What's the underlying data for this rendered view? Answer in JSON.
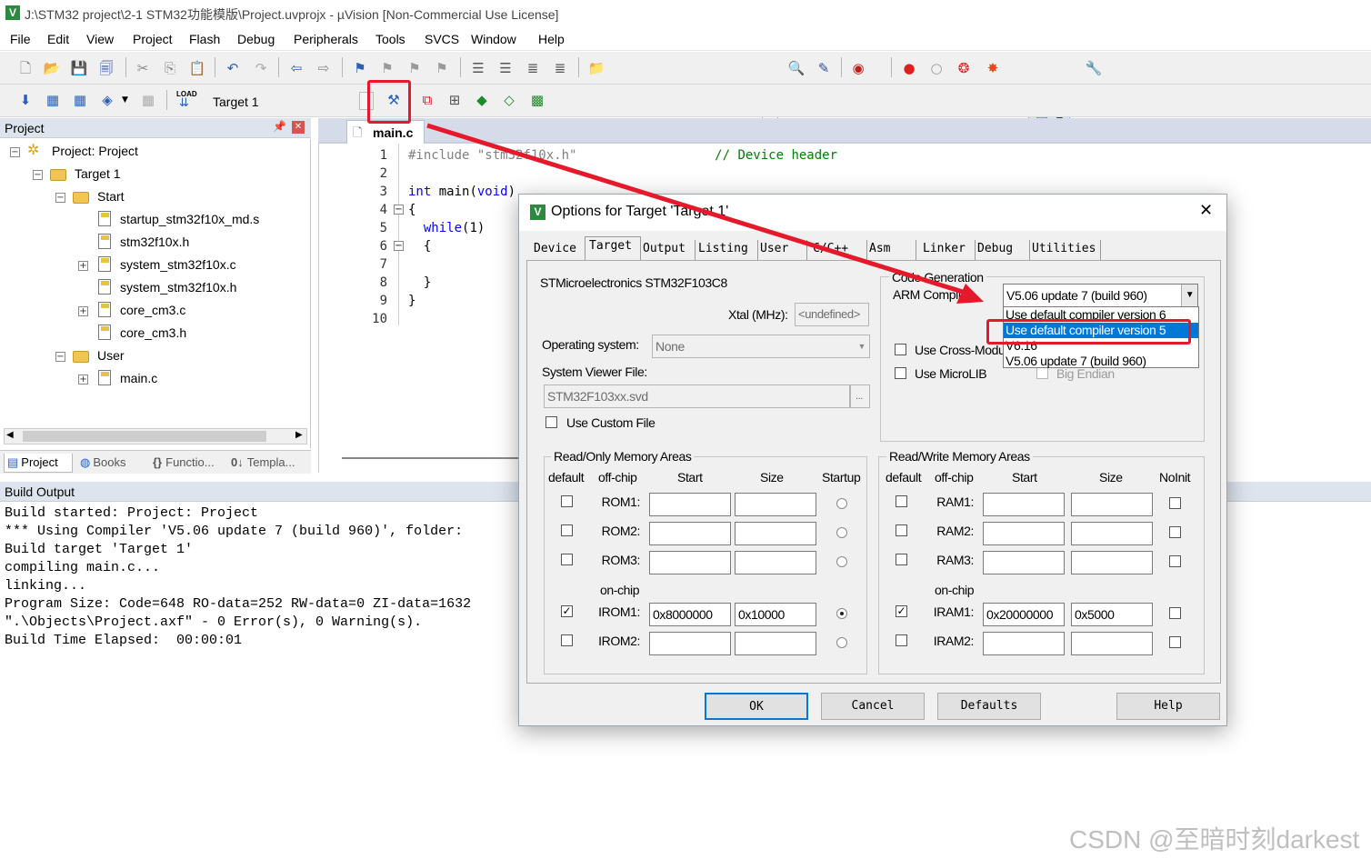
{
  "window": {
    "title": "J:\\STM32 project\\2-1 STM32功能模版\\Project.uvprojx - µVision  [Non-Commercial Use License]",
    "app_icon": "V"
  },
  "menu": [
    "File",
    "Edit",
    "View",
    "Project",
    "Flash",
    "Debug",
    "Peripherals",
    "Tools",
    "SVCS",
    "Window",
    "Help"
  ],
  "toolbar2": {
    "target_select": "Target 1",
    "load_label": "LOAD"
  },
  "project_panel": {
    "title": "Project",
    "tree": [
      {
        "label": "Project: Project",
        "kind": "root"
      },
      {
        "label": "Target 1",
        "kind": "target"
      },
      {
        "label": "Start",
        "kind": "folder"
      },
      {
        "label": "startup_stm32f10x_md.s",
        "kind": "file"
      },
      {
        "label": "stm32f10x.h",
        "kind": "file"
      },
      {
        "label": "system_stm32f10x.c",
        "kind": "file"
      },
      {
        "label": "system_stm32f10x.h",
        "kind": "file"
      },
      {
        "label": "core_cm3.c",
        "kind": "file"
      },
      {
        "label": "core_cm3.h",
        "kind": "file"
      },
      {
        "label": "User",
        "kind": "folder"
      },
      {
        "label": "main.c",
        "kind": "file"
      }
    ],
    "tabs": [
      "Project",
      "Books",
      "Functio...",
      "Templa..."
    ]
  },
  "editor": {
    "tab_label": "main.c",
    "lines": [
      {
        "num": "1",
        "segments": [
          {
            "text": "#include \"stm32f10x.h\"",
            "color": "#808080"
          },
          {
            "text": "                  // Device header",
            "color": "#008000"
          }
        ]
      },
      {
        "num": "2",
        "segments": []
      },
      {
        "num": "3",
        "segments": [
          {
            "text": "int",
            "color": "#0000ff"
          },
          {
            "text": " main(",
            "color": "#000000"
          },
          {
            "text": "void",
            "color": "#0000ff"
          },
          {
            "text": ")",
            "color": "#000000"
          }
        ]
      },
      {
        "num": "4",
        "segments": [
          {
            "text": "{",
            "color": "#000000"
          }
        ]
      },
      {
        "num": "5",
        "segments": [
          {
            "text": "  ",
            "color": "#000000"
          },
          {
            "text": "while",
            "color": "#0000ff"
          },
          {
            "text": "(1)",
            "color": "#000000"
          }
        ]
      },
      {
        "num": "6",
        "segments": [
          {
            "text": "  {",
            "color": "#000000"
          }
        ]
      },
      {
        "num": "7",
        "segments": []
      },
      {
        "num": "8",
        "segments": [
          {
            "text": "  }",
            "color": "#000000"
          }
        ]
      },
      {
        "num": "9",
        "segments": [
          {
            "text": "}",
            "color": "#000000"
          }
        ]
      },
      {
        "num": "10",
        "segments": []
      }
    ]
  },
  "build_output": {
    "title": "Build Output",
    "lines": [
      "Build started: Project: Project",
      "*** Using Compiler 'V5.06 update 7 (build 960)', folder:",
      "Build target 'Target 1'",
      "compiling main.c...",
      "linking...",
      "Program Size: Code=648 RO-data=252 RW-data=0 ZI-data=1632",
      "\".\\Objects\\Project.axf\" - 0 Error(s), 0 Warning(s).",
      "Build Time Elapsed:  00:00:01"
    ]
  },
  "dialog": {
    "title": "Options for Target 'Target 1'",
    "tabs": [
      "Device",
      "Target",
      "Output",
      "Listing",
      "User",
      "C/C++",
      "Asm",
      "Linker",
      "Debug",
      "Utilities"
    ],
    "active_tab": "Target",
    "device_name": "STMicroelectronics STM32F103C8",
    "xtal_label": "Xtal (MHz):",
    "xtal_value": "<undefined>",
    "os_label": "Operating system:",
    "os_value": "None",
    "svf_label": "System Viewer File:",
    "svf_value": "STM32F103xx.svd",
    "svf_browse": "...",
    "use_custom_file": "Use Custom File",
    "code_gen_label": "Code Generation",
    "arm_compiler_label": "ARM Compiler:",
    "compiler_selected": "V5.06 update 7 (build 960)",
    "compiler_options": [
      "Use default compiler version 6",
      "Use default compiler version 5",
      "V6.16",
      "V5.06 update 7 (build 960)"
    ],
    "compiler_highlighted_index": 1,
    "cross_module": "Use Cross-Module Optimization",
    "microlib": "Use MicroLIB",
    "big_endian": "Big Endian",
    "ro_title": "Read/Only Memory Areas",
    "rw_title": "Read/Write Memory Areas",
    "ro_headers": [
      "default",
      "off-chip",
      "Start",
      "Size",
      "Startup"
    ],
    "rw_headers": [
      "default",
      "off-chip",
      "Start",
      "Size",
      "NoInit"
    ],
    "on_chip": "on-chip",
    "ro_rows": [
      {
        "label": "ROM1:",
        "start": "",
        "size": "",
        "default": false,
        "startup": false
      },
      {
        "label": "ROM2:",
        "start": "",
        "size": "",
        "default": false,
        "startup": false
      },
      {
        "label": "ROM3:",
        "start": "",
        "size": "",
        "default": false,
        "startup": false
      },
      {
        "label": "IROM1:",
        "start": "0x8000000",
        "size": "0x10000",
        "default": true,
        "startup": true
      },
      {
        "label": "IROM2:",
        "start": "",
        "size": "",
        "default": false,
        "startup": false
      }
    ],
    "rw_rows": [
      {
        "label": "RAM1:",
        "start": "",
        "size": "",
        "default": false,
        "noinit": false
      },
      {
        "label": "RAM2:",
        "start": "",
        "size": "",
        "default": false,
        "noinit": false
      },
      {
        "label": "RAM3:",
        "start": "",
        "size": "",
        "default": false,
        "noinit": false
      },
      {
        "label": "IRAM1:",
        "start": "0x20000000",
        "size": "0x5000",
        "default": true,
        "noinit": false
      },
      {
        "label": "IRAM2:",
        "start": "",
        "size": "",
        "default": false,
        "noinit": false
      }
    ],
    "buttons": {
      "ok": "OK",
      "cancel": "Cancel",
      "defaults": "Defaults",
      "help": "Help"
    },
    "close_glyph": "✕"
  },
  "watermark": "CSDN @至暗时刻darkest",
  "colors": {
    "annotation_red": "#e6192b",
    "selection_blue": "#0078d7",
    "keyword_blue": "#0000ff",
    "comment_green": "#008000"
  }
}
